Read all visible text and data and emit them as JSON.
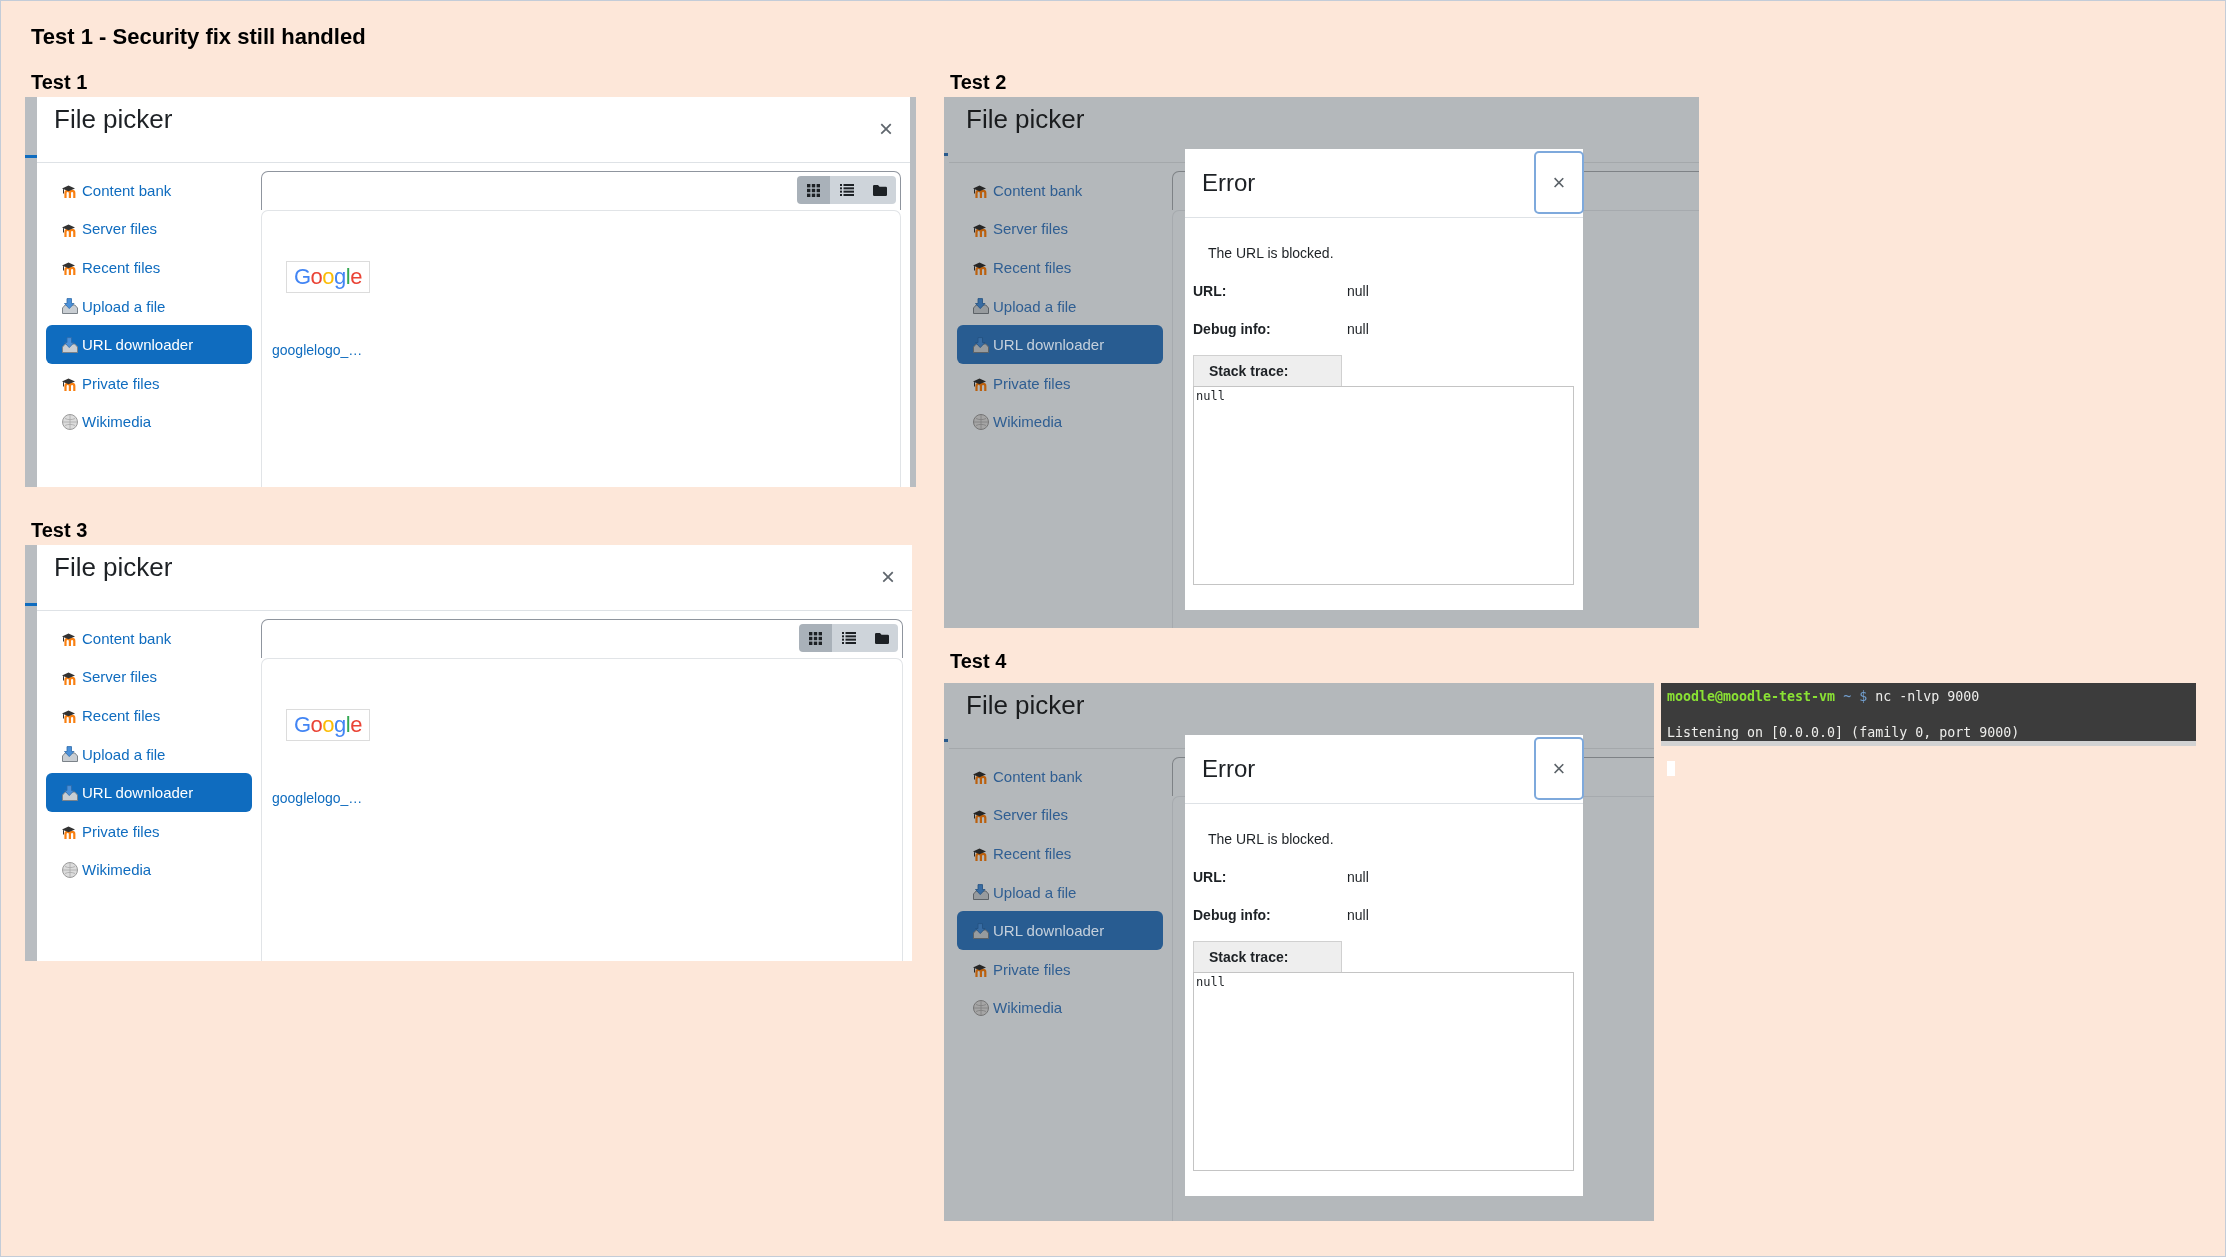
{
  "heading": "Test 1 - Security fix still handled",
  "tests": [
    {
      "label": "Test 1",
      "file_picker": {
        "title": "File picker",
        "close": "×",
        "repositories": [
          {
            "label": "Content bank",
            "kind": "moodle",
            "selected": false
          },
          {
            "label": "Server files",
            "kind": "moodle",
            "selected": false
          },
          {
            "label": "Recent files",
            "kind": "moodle",
            "selected": false
          },
          {
            "label": "Upload a file",
            "kind": "upload",
            "selected": false
          },
          {
            "label": "URL downloader",
            "kind": "upload",
            "selected": true
          },
          {
            "label": "Private files",
            "kind": "moodle",
            "selected": false
          },
          {
            "label": "Wikimedia",
            "kind": "wiki",
            "selected": false
          }
        ],
        "view_buttons": [
          {
            "kind": "icons",
            "selected": true
          },
          {
            "kind": "list",
            "selected": false
          },
          {
            "kind": "tree",
            "selected": false
          }
        ],
        "files": [
          {
            "name": "googlelogo_…",
            "thumbnail_text": "Google"
          }
        ]
      }
    },
    {
      "label": "Test 2",
      "file_picker": {
        "title": "File picker",
        "repositories": [
          {
            "label": "Content bank",
            "kind": "moodle",
            "selected": false
          },
          {
            "label": "Server files",
            "kind": "moodle",
            "selected": false
          },
          {
            "label": "Recent files",
            "kind": "moodle",
            "selected": false
          },
          {
            "label": "Upload a file",
            "kind": "upload",
            "selected": false
          },
          {
            "label": "URL downloader",
            "kind": "upload",
            "selected": true
          },
          {
            "label": "Private files",
            "kind": "moodle",
            "selected": false
          },
          {
            "label": "Wikimedia",
            "kind": "wiki",
            "selected": false
          }
        ]
      },
      "error_dialog": {
        "title": "Error",
        "close": "×",
        "message": "The URL is blocked.",
        "fields": [
          {
            "label": "URL:",
            "value": "null"
          },
          {
            "label": "Debug info:",
            "value": "null"
          }
        ],
        "stack_trace": {
          "label": "Stack trace:",
          "content": "null"
        }
      }
    },
    {
      "label": "Test 3",
      "file_picker": {
        "title": "File picker",
        "close": "×",
        "repositories": [
          {
            "label": "Content bank",
            "kind": "moodle",
            "selected": false
          },
          {
            "label": "Server files",
            "kind": "moodle",
            "selected": false
          },
          {
            "label": "Recent files",
            "kind": "moodle",
            "selected": false
          },
          {
            "label": "Upload a file",
            "kind": "upload",
            "selected": false
          },
          {
            "label": "URL downloader",
            "kind": "upload",
            "selected": true
          },
          {
            "label": "Private files",
            "kind": "moodle",
            "selected": false
          },
          {
            "label": "Wikimedia",
            "kind": "wiki",
            "selected": false
          }
        ],
        "view_buttons": [
          {
            "kind": "icons",
            "selected": true
          },
          {
            "kind": "list",
            "selected": false
          },
          {
            "kind": "tree",
            "selected": false
          }
        ],
        "files": [
          {
            "name": "googlelogo_…",
            "thumbnail_text": "Google"
          }
        ]
      }
    },
    {
      "label": "Test 4",
      "file_picker": {
        "title": "File picker",
        "repositories": [
          {
            "label": "Content bank",
            "kind": "moodle",
            "selected": false
          },
          {
            "label": "Server files",
            "kind": "moodle",
            "selected": false
          },
          {
            "label": "Recent files",
            "kind": "moodle",
            "selected": false
          },
          {
            "label": "Upload a file",
            "kind": "upload",
            "selected": false
          },
          {
            "label": "URL downloader",
            "kind": "upload",
            "selected": true
          },
          {
            "label": "Private files",
            "kind": "moodle",
            "selected": false
          },
          {
            "label": "Wikimedia",
            "kind": "wiki",
            "selected": false
          }
        ]
      },
      "error_dialog": {
        "title": "Error",
        "close": "×",
        "message": "The URL is blocked.",
        "fields": [
          {
            "label": "URL:",
            "value": "null"
          },
          {
            "label": "Debug info:",
            "value": "null"
          }
        ],
        "stack_trace": {
          "label": "Stack trace:",
          "content": "null"
        }
      },
      "terminal": {
        "prompt": {
          "user_host": "moodle@moodle-test-vm",
          "path": "~",
          "symbol": "$"
        },
        "command": "nc -nlvp 9000",
        "output": [
          "Listening on [0.0.0.0] (family 0, port 9000)"
        ],
        "cursor": true
      }
    }
  ]
}
